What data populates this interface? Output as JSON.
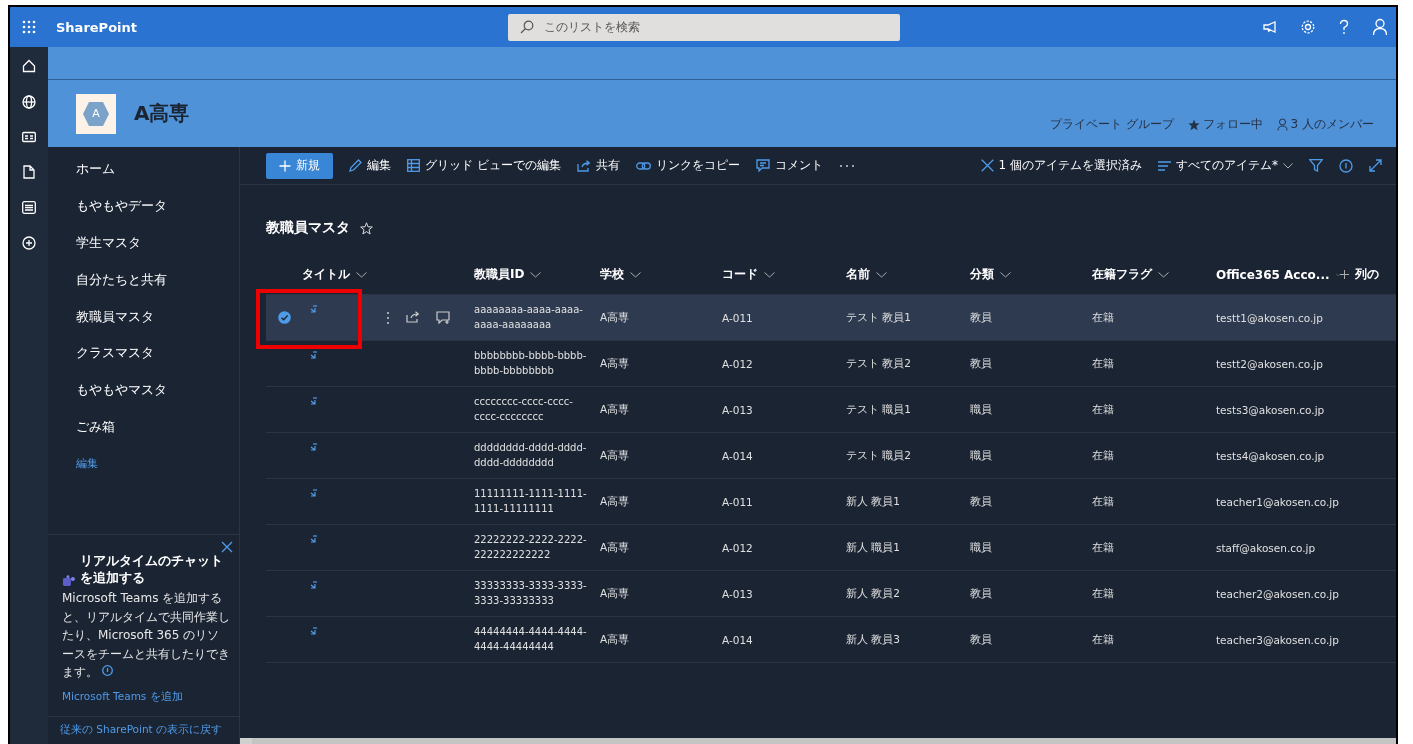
{
  "suite_bar": {
    "app_name": "SharePoint",
    "search": {
      "placeholder": "このリストを検索"
    }
  },
  "site_header": {
    "logo_letter": "A",
    "title": "A高専",
    "privacy": "プライベート グループ",
    "follow": "フォロー中",
    "members": "3 人のメンバー"
  },
  "nav": {
    "items": [
      {
        "label": "ホーム"
      },
      {
        "label": "もやもやデータ"
      },
      {
        "label": "学生マスタ"
      },
      {
        "label": "自分たちと共有"
      },
      {
        "label": "教職員マスタ"
      },
      {
        "label": "クラスマスタ"
      },
      {
        "label": "もやもやマスタ"
      },
      {
        "label": "ごみ箱"
      }
    ],
    "edit_link": "編集"
  },
  "teams_card": {
    "title": "リアルタイムのチャットを追加する",
    "body": "Microsoft Teams を追加すると、リアルタイムで共同作業したり、Microsoft 365 のリソースをチームと共有したりできます。",
    "link": "Microsoft Teams を追加"
  },
  "classic_link": "従来の SharePoint の表示に戻す",
  "command_bar": {
    "commands": [
      {
        "kind": "new",
        "label": "新規"
      },
      {
        "kind": "edit",
        "label": "編集"
      },
      {
        "kind": "grid",
        "label": "グリッド ビューでの編集"
      },
      {
        "kind": "share",
        "label": "共有"
      },
      {
        "kind": "link",
        "label": "リンクをコピー"
      },
      {
        "kind": "comment",
        "label": "コメント"
      }
    ],
    "selection": "1 個のアイテムを選択済み",
    "view": "すべてのアイテム*"
  },
  "list": {
    "title": "教職員マスタ",
    "columns": [
      "タイトル",
      "教職員ID",
      "学校",
      "コード",
      "名前",
      "分類",
      "在籍フラグ",
      "Office365 Acco..."
    ],
    "add_column": "列の",
    "rows": [
      {
        "selected": true,
        "highlighted": true,
        "id": "aaaaaaaa-aaaa-aaaa-aaaa-aaaaaaaa",
        "school": "A高専",
        "code": "A-011",
        "name": "テスト 教員1",
        "category": "教員",
        "flag": "在籍",
        "email": "testt1@akosen.co.jp"
      },
      {
        "selected": false,
        "highlighted": false,
        "id": "bbbbbbbb-bbbb-bbbb-bbbb-bbbbbbbb",
        "school": "A高専",
        "code": "A-012",
        "name": "テスト 教員2",
        "category": "教員",
        "flag": "在籍",
        "email": "testt2@akosen.co.jp"
      },
      {
        "selected": false,
        "highlighted": false,
        "id": "cccccccc-cccc-cccc-cccc-cccccccc",
        "school": "A高専",
        "code": "A-013",
        "name": "テスト 職員1",
        "category": "職員",
        "flag": "在籍",
        "email": "tests3@akosen.co.jp"
      },
      {
        "selected": false,
        "highlighted": false,
        "id": "dddddddd-dddd-dddd-dddd-dddddddd",
        "school": "A高専",
        "code": "A-014",
        "name": "テスト 職員2",
        "category": "職員",
        "flag": "在籍",
        "email": "tests4@akosen.co.jp"
      },
      {
        "selected": false,
        "highlighted": false,
        "id": "11111111-1111-1111-1111-11111111",
        "school": "A高専",
        "code": "A-011",
        "name": "新人 教員1",
        "category": "教員",
        "flag": "在籍",
        "email": "teacher1@akosen.co.jp"
      },
      {
        "selected": false,
        "highlighted": false,
        "id": "22222222-2222-2222-222222222222",
        "school": "A高専",
        "code": "A-012",
        "name": "新人 職員1",
        "category": "職員",
        "flag": "在籍",
        "email": "staff@akosen.co.jp"
      },
      {
        "selected": false,
        "highlighted": false,
        "id": "33333333-3333-3333-3333-33333333",
        "school": "A高専",
        "code": "A-013",
        "name": "新人 教員2",
        "category": "教員",
        "flag": "在籍",
        "email": "teacher2@akosen.co.jp"
      },
      {
        "selected": false,
        "highlighted": false,
        "id": "44444444-4444-4444-4444-44444444",
        "school": "A高専",
        "code": "A-014",
        "name": "新人 教員3",
        "category": "教員",
        "flag": "在籍",
        "email": "teacher3@akosen.co.jp"
      }
    ]
  }
}
